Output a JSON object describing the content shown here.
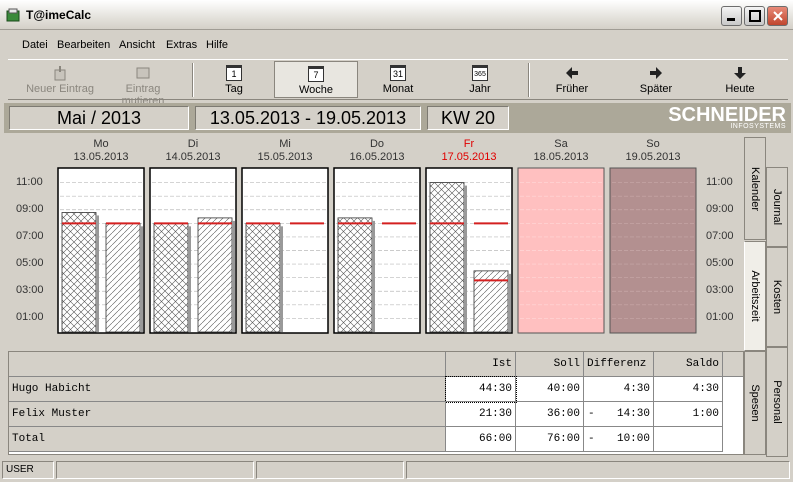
{
  "window": {
    "title": "T@imeCalc"
  },
  "menu": [
    "Datei",
    "Bearbeiten",
    "Ansicht",
    "Extras",
    "Hilfe"
  ],
  "toolbar": {
    "new_entry": "Neuer Eintrag",
    "mutate_entry": "Eintrag mutieren",
    "day": "Tag",
    "day_icon": "1",
    "week": "Woche",
    "week_icon": "7",
    "month": "Monat",
    "month_icon": "31",
    "year": "Jahr",
    "year_icon": "365",
    "earlier": "Früher",
    "later": "Später",
    "today": "Heute"
  },
  "header": {
    "month": "Mai / 2013",
    "range": "13.05.2013 - 19.05.2013",
    "week": "KW 20",
    "logo": "SCHNEIDER",
    "logo_sub": "INFOSYSTEMS"
  },
  "chart": {
    "y_ticks": [
      "11:00",
      "09:00",
      "07:00",
      "05:00",
      "03:00",
      "01:00"
    ],
    "days": [
      {
        "name": "Mo",
        "date": "13.05.2013",
        "ist": 8.8,
        "soll": 8.0,
        "type": "work",
        "today": false
      },
      {
        "name": "Di",
        "date": "14.05.2013",
        "ist": 8.0,
        "soll": 8.0,
        "ist2": 8.4,
        "type": "work",
        "today": false
      },
      {
        "name": "Mi",
        "date": "15.05.2013",
        "ist": 8.0,
        "soll": 8.0,
        "ist2": 0,
        "type": "work",
        "today": false
      },
      {
        "name": "Do",
        "date": "16.05.2013",
        "ist": 8.4,
        "soll": 8.0,
        "ist2": 0,
        "type": "work",
        "today": false
      },
      {
        "name": "Fr",
        "date": "17.05.2013",
        "ist": 11.0,
        "soll": 8.0,
        "ist2": 4.5,
        "type": "work",
        "today": true
      },
      {
        "name": "Sa",
        "date": "18.05.2013",
        "type": "saturday",
        "today": false
      },
      {
        "name": "So",
        "date": "19.05.2013",
        "type": "sunday",
        "today": false
      }
    ],
    "colors": {
      "saturday": "#ffc0c0",
      "sunday": "#b39090",
      "soll_line": "#d42020"
    }
  },
  "tabs": [
    "Kalender",
    "Journal",
    "Arbeitszeit",
    "Kosten",
    "Spesen",
    "Personal"
  ],
  "table": {
    "headers": [
      "",
      "Ist",
      "Soll",
      "Differenz",
      "Saldo"
    ],
    "rows": [
      {
        "name": "Hugo Habicht",
        "ist": "44:30",
        "soll": "40:00",
        "sign": "",
        "diff": "4:30",
        "saldo": "4:30"
      },
      {
        "name": "Felix Muster",
        "ist": "21:30",
        "soll": "36:00",
        "sign": "-",
        "diff": "14:30",
        "saldo": "1:00"
      },
      {
        "name": "Total",
        "ist": "66:00",
        "soll": "76:00",
        "sign": "-",
        "diff": "10:00",
        "saldo": ""
      }
    ]
  },
  "status": {
    "user": "USER"
  }
}
